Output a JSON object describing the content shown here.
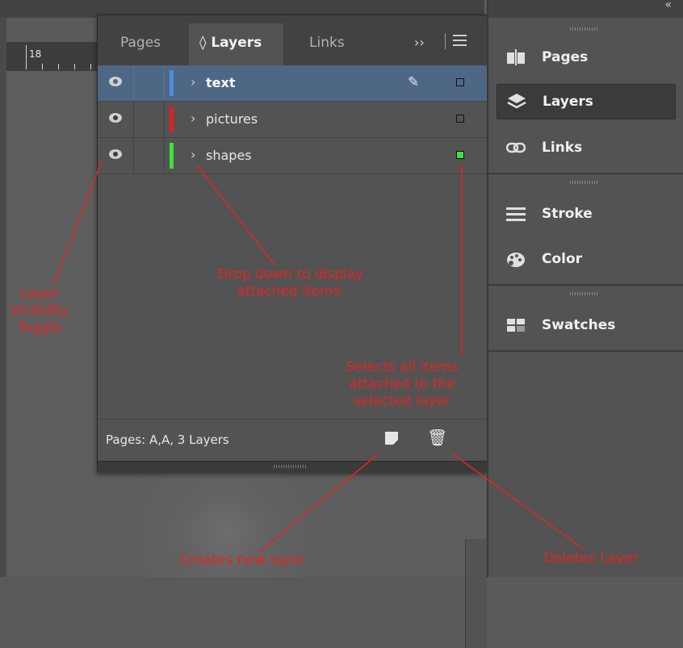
{
  "ruler": {
    "number": "18"
  },
  "panel": {
    "tabs": [
      {
        "label": "Pages"
      },
      {
        "label": "Layers",
        "prefix": "◊"
      },
      {
        "label": "Links"
      }
    ],
    "more": "››",
    "layers": [
      {
        "name": "text",
        "color": "#4d8fe0",
        "selected": true,
        "pen": true,
        "square_fill": "transparent"
      },
      {
        "name": "pictures",
        "color": "#e02020",
        "selected": false,
        "pen": false,
        "square_fill": "transparent"
      },
      {
        "name": "shapes",
        "color": "#3ee03e",
        "selected": false,
        "pen": false,
        "square_fill": "#3ee03e"
      }
    ],
    "footer_text": "Pages: A,A, 3 Layers"
  },
  "dock": {
    "items": [
      {
        "label": "Pages",
        "icon": "pages-icon",
        "active": false
      },
      {
        "label": "Layers",
        "icon": "layers-icon",
        "active": true
      },
      {
        "label": "Links",
        "icon": "links-icon",
        "active": false
      },
      {
        "label": "Stroke",
        "icon": "stroke-icon",
        "active": false
      },
      {
        "label": "Color",
        "icon": "color-icon",
        "active": false
      },
      {
        "label": "Swatches",
        "icon": "swatches-icon",
        "active": false
      }
    ]
  },
  "annotations": {
    "visibility": "Layer Visibility Toggle",
    "dropdown": "Drop down to display attached items.",
    "selects": "Selects all items attached to the selected layer",
    "new_layer": "Creates new layer",
    "delete_layer": "Deletes Layer"
  },
  "colors": {
    "annotation": "#e02525",
    "selected_row": "#4e6785"
  }
}
